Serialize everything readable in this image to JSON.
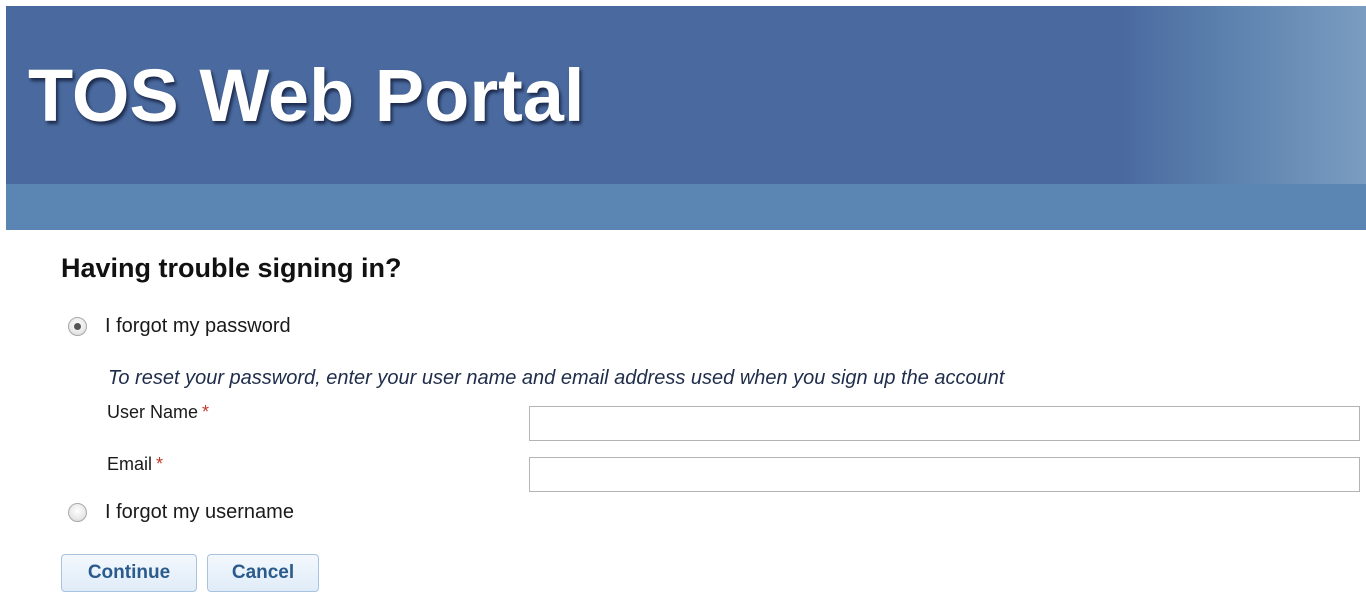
{
  "header": {
    "title": "TOS Web Portal"
  },
  "main": {
    "heading": "Having trouble signing in?",
    "options": [
      {
        "label": "I forgot my password",
        "selected": true
      },
      {
        "label": "I forgot my username",
        "selected": false
      }
    ],
    "instructions": "To reset your password, enter your user name and email address used when you sign up the account",
    "fields": {
      "user_name": {
        "label": "User Name",
        "required_marker": "*",
        "value": ""
      },
      "email": {
        "label": "Email",
        "required_marker": "*",
        "value": ""
      }
    },
    "buttons": {
      "continue": "Continue",
      "cancel": "Cancel"
    }
  },
  "colors": {
    "header_banner": "#4a6a9f",
    "sub_bar": "#5b86b3",
    "button_text": "#2b5b8c",
    "required": "#c0392b"
  }
}
